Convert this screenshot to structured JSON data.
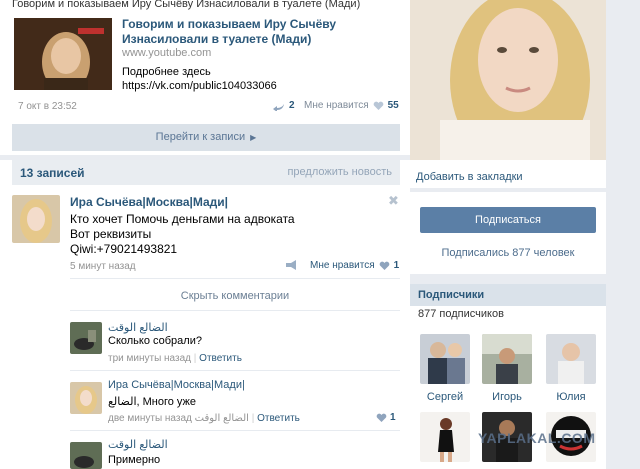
{
  "top_post": {
    "truncated_header": "Говорим и показываем Иру Сычёву Изнасиловали в туалете (Мади)",
    "video_title": "Говорим и показываем Иру Сычёву Изнасиловали в туалете (Мади)",
    "video_url": "www.youtube.com",
    "details_label": "Подробнее здесь",
    "details_link": "https://vk.com/public104033066",
    "date": "7 окт в 23:52",
    "reposts": "2",
    "like_label": "Мне нравится",
    "likes": "55"
  },
  "goto_post_label": "Перейти к записи",
  "wall": {
    "count_label": "13 записей",
    "suggest_label": "предложить новость"
  },
  "post": {
    "author": "Ира Сычёва|Москва|Мади|",
    "text_lines": [
      "Кто хочет Помочь деньгами на адвоката",
      "Вот реквизиты",
      "Qiwi:+79021493821"
    ],
    "time": "5 минут назад",
    "like_label": "Мне нравится",
    "likes": "1",
    "hide_comments": "Скрыть комментарии"
  },
  "comments": [
    {
      "author": "الضالع الوقت",
      "text": "Сколько собрали?",
      "time": "три минуты назад",
      "reply": "Ответить",
      "likes": ""
    },
    {
      "author": "Ира Сычёва|Москва|Мади|",
      "text": "الضالع, Много уже",
      "time": "две минуты назад",
      "to": "الضالع الوقت",
      "reply": "Ответить",
      "likes": "1"
    },
    {
      "author": "الضالع الوقت",
      "text": "Примерно",
      "time": "",
      "reply": "",
      "likes": ""
    }
  ],
  "sidebar": {
    "bookmark_label": "Добавить в закладки",
    "subscribe_button": "Подписаться",
    "subscribed_label": "Подписались 877 человек",
    "subscribers_title": "Подписчики",
    "subscribers_count": "877 подписчиков",
    "subscribers": [
      {
        "name": "Сергей"
      },
      {
        "name": "Игорь"
      },
      {
        "name": "Юлия"
      }
    ]
  },
  "watermark": "YAPLAKAL.COM",
  "colors": {
    "link": "#2b587a",
    "button": "#5b7fa6",
    "background": "#e9ecf1"
  }
}
